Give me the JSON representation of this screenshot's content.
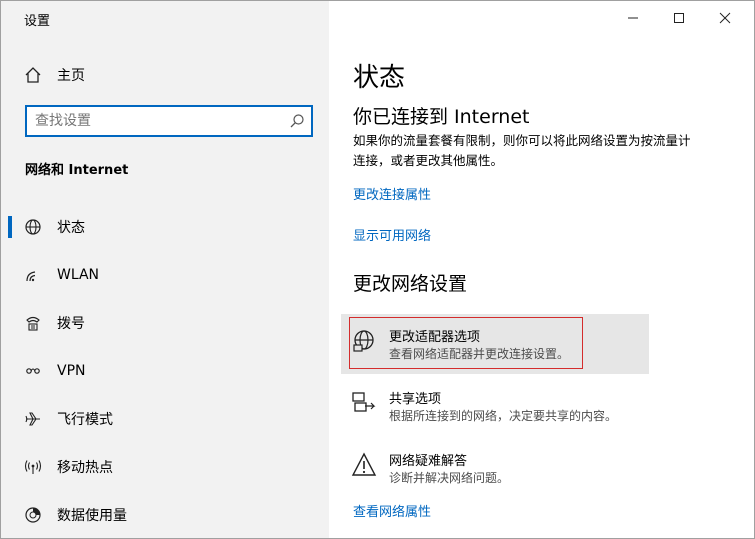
{
  "window": {
    "title": "设置"
  },
  "sidebar": {
    "home_label": "主页",
    "search_placeholder": "查找设置",
    "section_title": "网络和 Internet",
    "items": [
      {
        "label": "状态",
        "icon": "globe-icon",
        "active": true
      },
      {
        "label": "WLAN",
        "icon": "wifi-icon",
        "active": false
      },
      {
        "label": "拨号",
        "icon": "dialup-icon",
        "active": false
      },
      {
        "label": "VPN",
        "icon": "vpn-icon",
        "active": false
      },
      {
        "label": "飞行模式",
        "icon": "airplane-icon",
        "active": false
      },
      {
        "label": "移动热点",
        "icon": "hotspot-icon",
        "active": false
      },
      {
        "label": "数据使用量",
        "icon": "data-usage-icon",
        "active": false
      }
    ]
  },
  "main": {
    "title": "状态",
    "connection_heading": "你已连接到 Internet",
    "connection_text_line1": "如果你的流量套餐有限制，则你可以将此网络设置为按流量计",
    "connection_text_line2": "连接，或者更改其他属性。",
    "link_change_connection_props": "更改连接属性",
    "link_show_networks": "显示可用网络",
    "change_settings_heading": "更改网络设置",
    "options": [
      {
        "title": "更改适配器选项",
        "desc": "查看网络适配器并更改连接设置。",
        "icon": "adapter-icon"
      },
      {
        "title": "共享选项",
        "desc": "根据所连接到的网络，决定要共享的内容。",
        "icon": "sharing-icon"
      },
      {
        "title": "网络疑难解答",
        "desc": "诊断并解决网络问题。",
        "icon": "warning-icon"
      }
    ],
    "link_view_network_props": "查看网络属性"
  },
  "colors": {
    "accent": "#0067c0",
    "highlight_box": "#d42c2c",
    "sidebar_bg": "#f2f2f2"
  }
}
